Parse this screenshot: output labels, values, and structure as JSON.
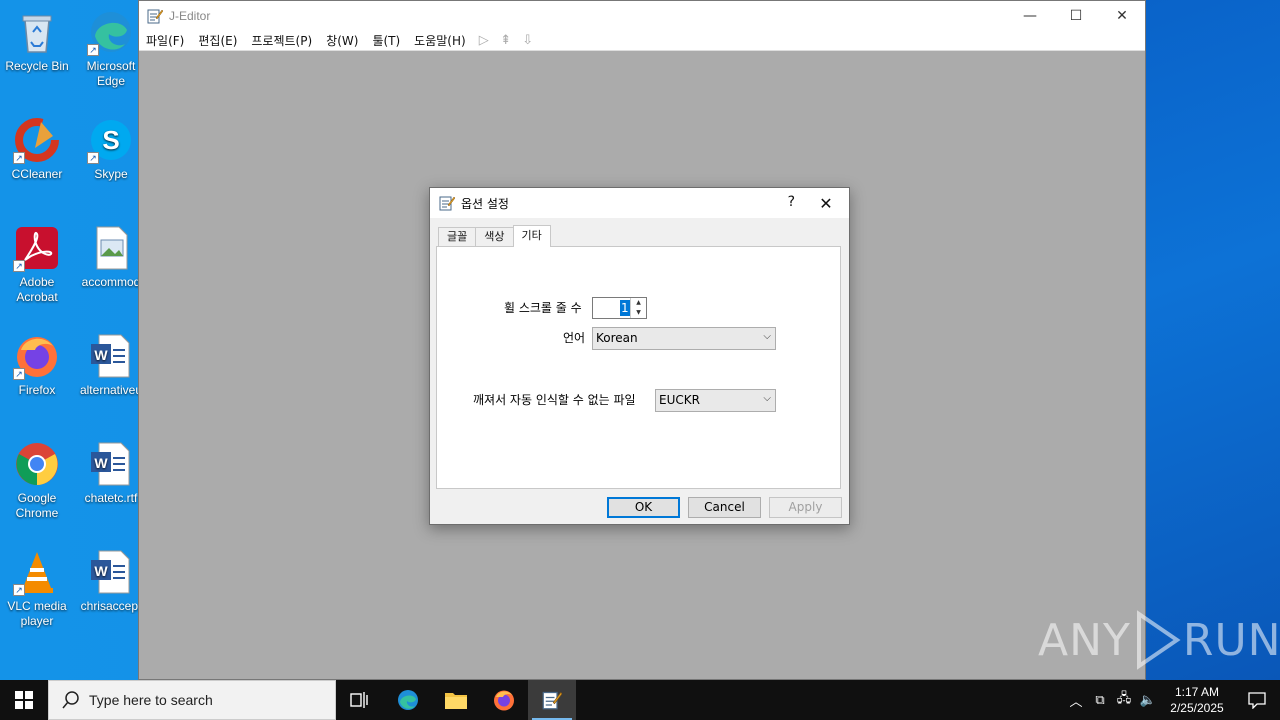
{
  "desktop": {
    "icons": [
      {
        "label": "Recycle Bin",
        "icon": "recycle-bin-icon"
      },
      {
        "label": "Microsoft Edge",
        "icon": "edge-icon"
      },
      {
        "label": "CCleaner",
        "icon": "ccleaner-icon"
      },
      {
        "label": "Skype",
        "icon": "skype-icon"
      },
      {
        "label": "Adobe Acrobat",
        "icon": "acrobat-icon"
      },
      {
        "label": "accommod",
        "icon": "image-file-icon"
      },
      {
        "label": "Firefox",
        "icon": "firefox-icon"
      },
      {
        "label": "alternativeu",
        "icon": "word-doc-icon"
      },
      {
        "label": "Google Chrome",
        "icon": "chrome-icon"
      },
      {
        "label": "chatetc.rtf",
        "icon": "word-doc-icon"
      },
      {
        "label": "VLC media player",
        "icon": "vlc-icon"
      },
      {
        "label": "chrisaccep.",
        "icon": "word-doc-icon"
      }
    ]
  },
  "editor": {
    "title": "J-Editor",
    "menu": [
      "파일(F)",
      "편집(E)",
      "프로젝트(P)",
      "창(W)",
      "툴(T)",
      "도움말(H)"
    ],
    "window_buttons": {
      "minimize": "—",
      "maximize": "☐",
      "close": "✕"
    }
  },
  "dialog": {
    "title": "옵션 설정",
    "help": "?",
    "close": "✕",
    "tabs": [
      "글꼴",
      "색상",
      "기타"
    ],
    "active_tab": "기타",
    "fields": {
      "scroll_lines_label": "휠 스크롤 줄 수",
      "scroll_lines_value": "1",
      "language_label": "언어",
      "language_value": "Korean",
      "fallback_encoding_label": "깨져서 자동 인식할 수 없는 파일",
      "fallback_encoding_value": "EUCKR"
    },
    "buttons": {
      "ok": "OK",
      "cancel": "Cancel",
      "apply": "Apply"
    }
  },
  "watermark": {
    "left": "ANY",
    "right": "RUN"
  },
  "taskbar": {
    "search_placeholder": "Type here to search",
    "apps": [
      "task-view-icon",
      "edge-icon",
      "file-explorer-icon",
      "firefox-icon",
      "j-editor-icon"
    ],
    "time": "1:17 AM",
    "date": "2/25/2025"
  }
}
